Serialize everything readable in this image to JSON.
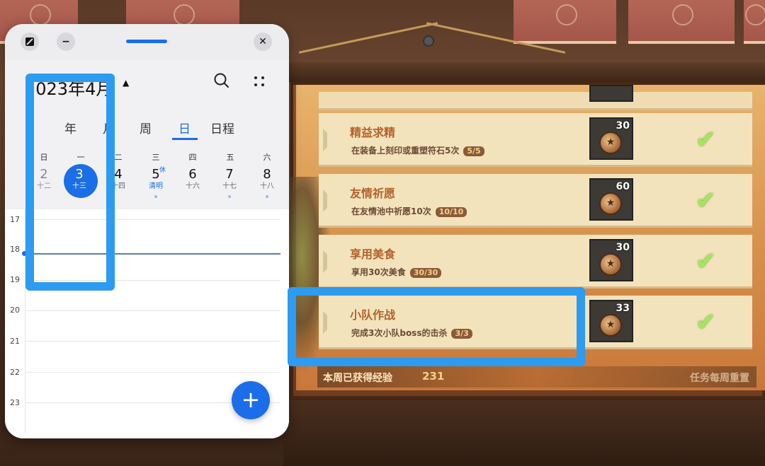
{
  "calendar": {
    "month_title": "2023年4月",
    "tabs": [
      "年",
      "月",
      "周",
      "日",
      "日程"
    ],
    "active_tab": "日",
    "weekdays": [
      "日",
      "一",
      "二",
      "三",
      "四",
      "五",
      "六"
    ],
    "days": [
      {
        "num": "2",
        "lunar": "十二"
      },
      {
        "num": "3",
        "lunar": "十三"
      },
      {
        "num": "4",
        "lunar": "十四"
      },
      {
        "num": "5",
        "lunar": "清明",
        "tag": "休"
      },
      {
        "num": "6",
        "lunar": "十六"
      },
      {
        "num": "7",
        "lunar": "十七"
      },
      {
        "num": "8",
        "lunar": "十八"
      }
    ],
    "hours": [
      "17",
      "18",
      "19",
      "20",
      "21",
      "22",
      "23"
    ],
    "fab_label": "+",
    "accent": "#1b6ee8"
  },
  "window": {
    "close_label": "✕",
    "minimize_label": "−"
  },
  "game": {
    "quests": [
      {
        "title": "精益求精",
        "desc": "在装备上刻印或重塑符石5次",
        "progress": "5/5",
        "reward": "30"
      },
      {
        "title": "友情祈愿",
        "desc": "在友情池中祈愿10次",
        "progress": "10/10",
        "reward": "60"
      },
      {
        "title": "享用美食",
        "desc": "享用30次美食",
        "progress": "30/30",
        "reward": "30"
      },
      {
        "title": "小队作战",
        "desc": "完成3次小队boss的击杀",
        "progress": "3/3",
        "reward": "33"
      }
    ],
    "weekly_label": "本周已获得经验",
    "weekly_value": "231",
    "weekly_reset": "任务每周重置"
  },
  "highlight_color": "#2d9bef"
}
